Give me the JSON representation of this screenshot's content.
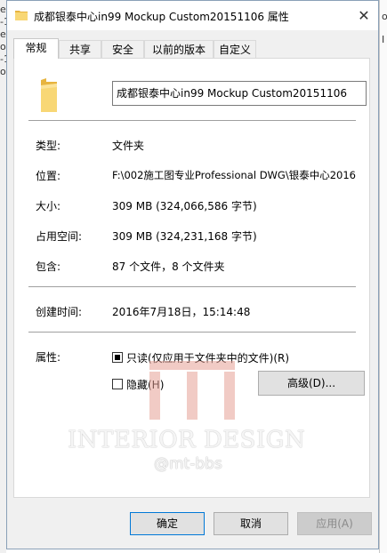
{
  "left_strip": {
    "items": [
      "e",
      "-1",
      "e",
      "ol",
      "-1",
      "ol"
    ]
  },
  "right_strip": {
    "items": [
      "o",
      "I"
    ]
  },
  "window": {
    "title": "成都银泰中心in99 Mockup Custom20151106 属性",
    "close_glyph": "✕"
  },
  "tabs": [
    "常规",
    "共享",
    "安全",
    "以前的版本",
    "自定义"
  ],
  "active_tab": 0,
  "general": {
    "name": "成都银泰中心in99 Mockup Custom20151106",
    "type_label": "类型:",
    "type_value": "文件夹",
    "location_label": "位置:",
    "location_value": "F:\\002施工图专业Professional DWG\\银泰中心2016",
    "size_label": "大小:",
    "size_value": "309 MB (324,066,586 字节)",
    "disk_size_label": "占用空间:",
    "disk_size_value": "309 MB (324,231,168 字节)",
    "contains_label": "包含:",
    "contains_value": "87 个文件，8 个文件夹",
    "created_label": "创建时间:",
    "created_value": "2016年7月18日，15:14:48",
    "attributes_label": "属性:",
    "readonly_label": "只读(仅应用于文件夹中的文件)(R)",
    "hidden_label": "隐藏(H)",
    "advanced_label": "高级(D)..."
  },
  "buttons": {
    "ok": "确定",
    "cancel": "取消",
    "apply": "应用(A)"
  },
  "watermark": {
    "main": "INTERIOR DESIGN",
    "sub": "@mt-bbs"
  },
  "colors": {
    "folder": "#f8d775",
    "folder_dark": "#e7b43f",
    "accent_border": "#0078d7"
  }
}
